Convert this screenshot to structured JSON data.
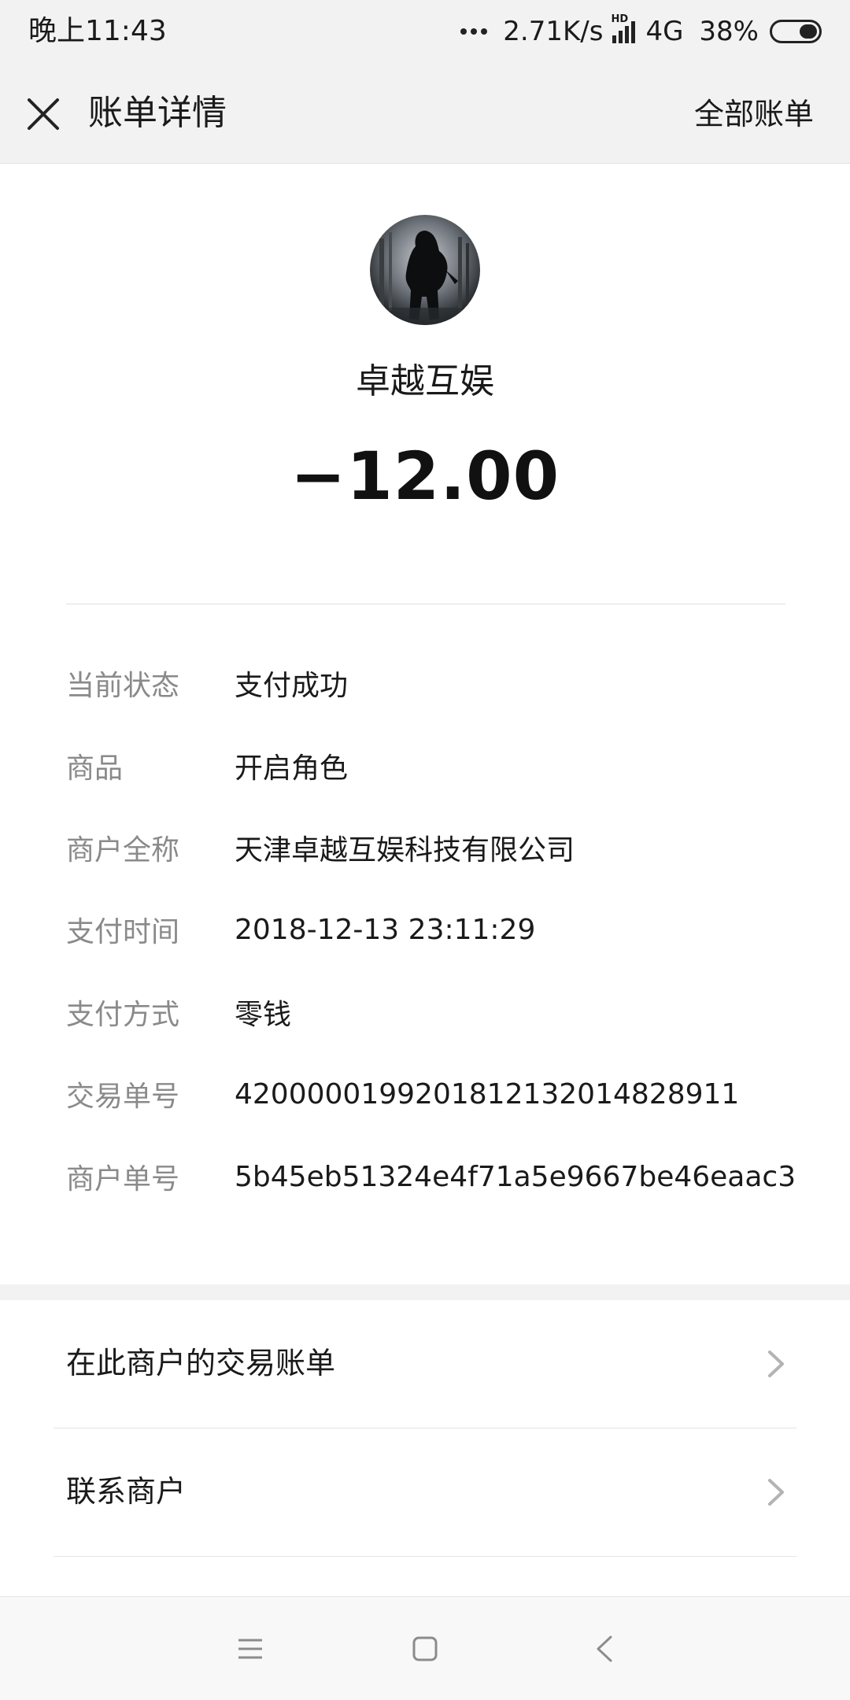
{
  "status_bar": {
    "time": "晚上11:43",
    "network_speed": "2.71K/s",
    "hd_badge": "HD",
    "network_type": "4G",
    "battery": "38%"
  },
  "header": {
    "title": "账单详情",
    "all_bills": "全部账单",
    "close_icon": "close-icon"
  },
  "merchant": {
    "name": "卓越互娱",
    "amount": "−12.00",
    "avatar_icon": "merchant-avatar"
  },
  "details": [
    {
      "label": "当前状态",
      "value": "支付成功"
    },
    {
      "label": "商品",
      "value": "开启角色"
    },
    {
      "label": "商户全称",
      "value": "天津卓越互娱科技有限公司"
    },
    {
      "label": "支付时间",
      "value": "2018-12-13 23:11:29"
    },
    {
      "label": "支付方式",
      "value": "零钱"
    },
    {
      "label": "交易单号",
      "value": "4200000199201812132014828911"
    },
    {
      "label": "商户单号",
      "value": "5b45eb51324e4f71a5e9667be46eaac3"
    }
  ],
  "menu": [
    {
      "label": "在此商户的交易账单",
      "icon": "chevron-right-icon"
    },
    {
      "label": "联系商户",
      "icon": "chevron-right-icon"
    }
  ],
  "nav_bar": {
    "menu_icon": "menu-icon",
    "home_icon": "home-icon",
    "back_icon": "back-icon"
  },
  "colors": {
    "background": "#ffffff",
    "bar_background": "#f2f2f2",
    "label_gray": "#8a8a8a",
    "text_dark": "#1a1a1a",
    "divider": "#e0e0e0"
  }
}
